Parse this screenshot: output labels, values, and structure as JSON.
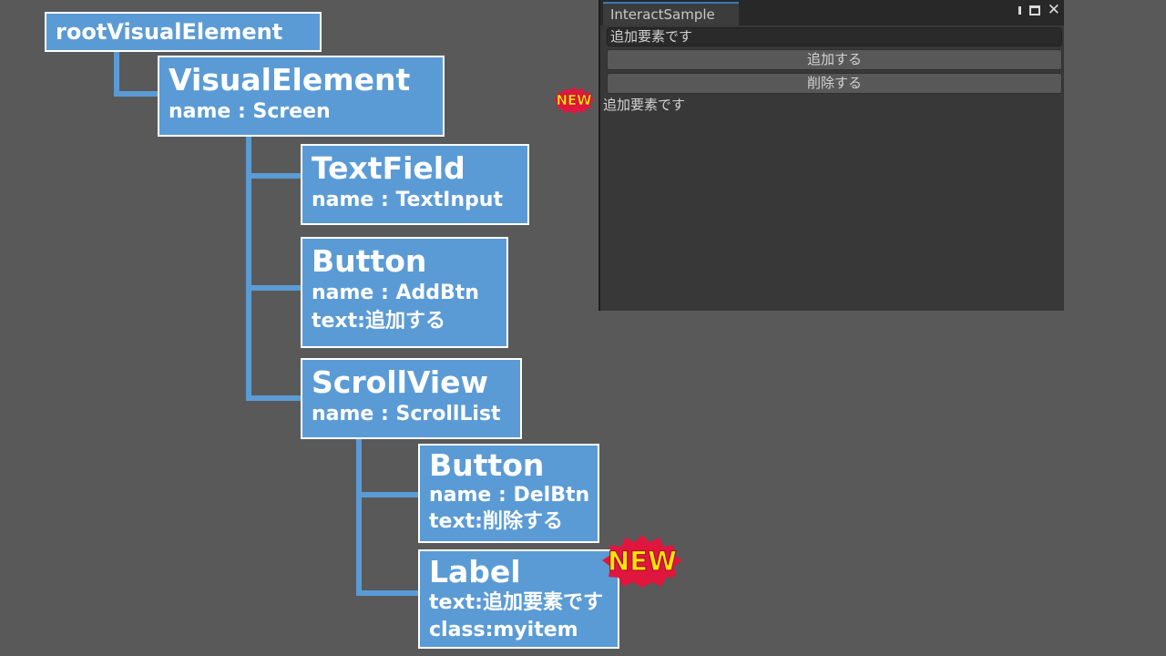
{
  "tree": {
    "root": {
      "title": "rootVisualElement"
    },
    "screen": {
      "title": "VisualElement",
      "name": "name : Screen"
    },
    "textfield": {
      "title": "TextField",
      "name": "name : TextInput"
    },
    "addbtn": {
      "title": "Button",
      "name": "name : AddBtn",
      "text": "text:追加する"
    },
    "scrollview": {
      "title": "ScrollView",
      "name": "name : ScrollList"
    },
    "delbtn": {
      "title": "Button",
      "name": "name : DelBtn",
      "text": "text:削除する"
    },
    "label": {
      "title": "Label",
      "text": "text:追加要素です",
      "class": "class:myitem"
    }
  },
  "badge": {
    "label": "NEW"
  },
  "window": {
    "tab_title": "InteractSample",
    "textfield_value": "追加要素です",
    "add_button_label": "追加する",
    "delete_button_label": "削除する",
    "item_label": "追加要素です"
  },
  "colors": {
    "node_fill": "#5b9bd5",
    "badge_fill": "#e0163f",
    "badge_text": "#ffe600",
    "background": "#595959"
  }
}
